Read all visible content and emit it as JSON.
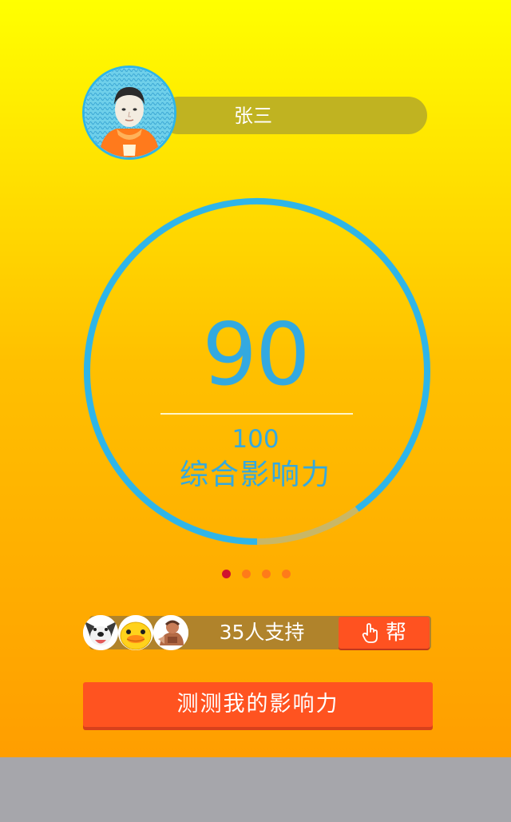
{
  "profile": {
    "name": "张三",
    "avatar_icon": "boy-portrait-icon"
  },
  "influence": {
    "score": "90",
    "total": "100",
    "label": "综合影响力",
    "progress_fraction": 0.9,
    "ring_color": "#2fb5e8",
    "track_color": "#c9b766"
  },
  "pager": {
    "count": 4,
    "active_index": 0,
    "active_color": "#d0142d",
    "inactive_color": "#ff7b19"
  },
  "support": {
    "text": "35人支持",
    "avatars": [
      "dog-face-icon",
      "yellow-duck-icon",
      "cartoon-character-icon"
    ],
    "help_label": "帮",
    "help_icon": "pointing-hand-icon"
  },
  "actions": {
    "test_label": "测测我的影响力"
  },
  "colors": {
    "background_top": "#ffff00",
    "background_bottom": "#ff9e00",
    "primary_button": "#ff5320",
    "footer": "#a6a6ab"
  }
}
